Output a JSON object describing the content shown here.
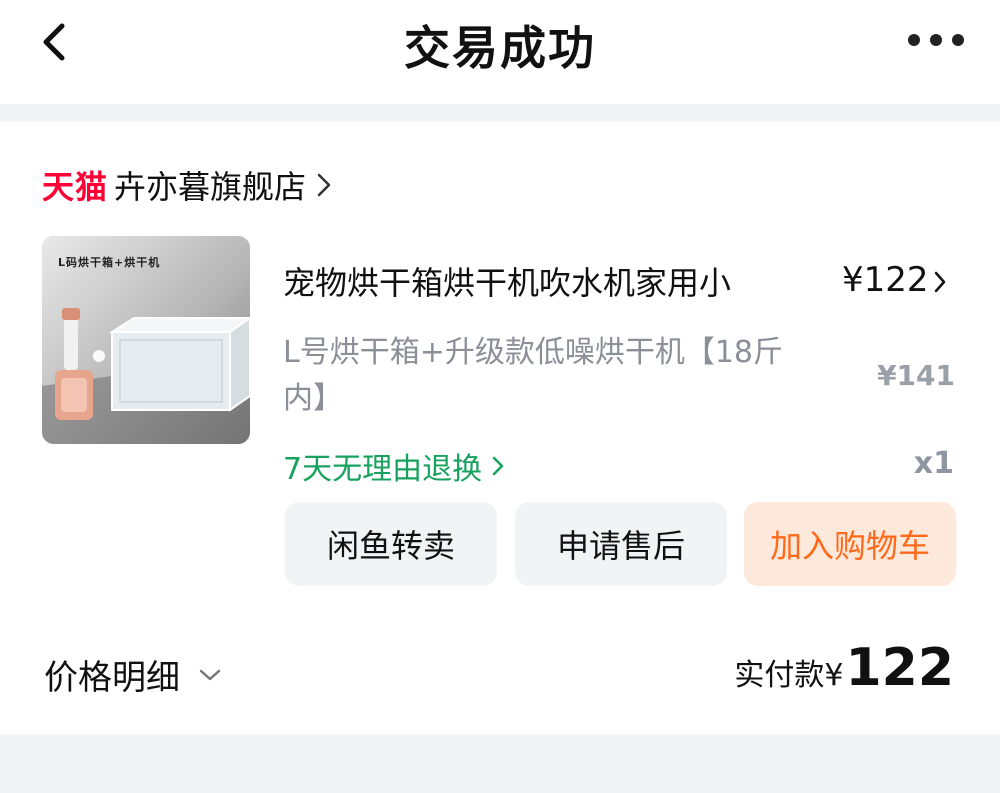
{
  "header": {
    "title": "交易成功"
  },
  "store": {
    "platform": "天猫",
    "name": "卉亦暮旗舰店"
  },
  "product": {
    "title": "宠物烘干箱烘干机吹水机家用小",
    "price": "¥122",
    "spec": "L号烘干箱+升级款低噪烘干机【18斤内】",
    "original_price": "¥141",
    "return_policy": "7天无理由退换",
    "quantity": "x1",
    "image_label": "L码烘干箱+烘干机"
  },
  "actions": {
    "resell": "闲鱼转卖",
    "after_sale": "申请售后",
    "add_cart": "加入购物车"
  },
  "summary": {
    "detail_label": "价格明细",
    "paid_label": "实付款¥",
    "paid_amount": "122"
  },
  "colors": {
    "tmall_red": "#ff0036",
    "green": "#18a25e",
    "orange": "#ff6a1a",
    "cart_bg": "#fde8dc"
  }
}
